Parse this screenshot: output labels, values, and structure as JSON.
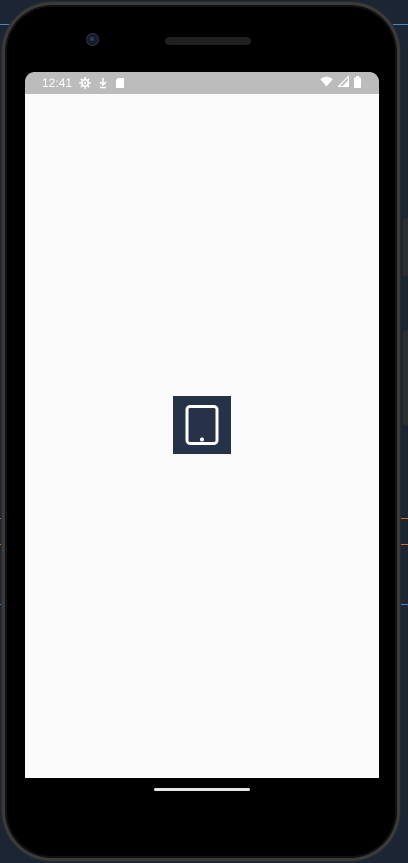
{
  "status_bar": {
    "time": "12:41",
    "left_icons": [
      "settings-gear-icon",
      "download-arrow-icon",
      "sd-card-icon"
    ],
    "right_icons": [
      "wifi-icon",
      "signal-icon",
      "battery-icon"
    ],
    "background": "#bcbcbc"
  },
  "screen": {
    "background": "#fafafa",
    "center_icon": {
      "name": "tablet-icon",
      "background": "#253248"
    }
  },
  "colors": {
    "device_frame": "#000000",
    "accent_line_blue": "#4a86c5",
    "accent_line_orange": "#c9702b"
  }
}
